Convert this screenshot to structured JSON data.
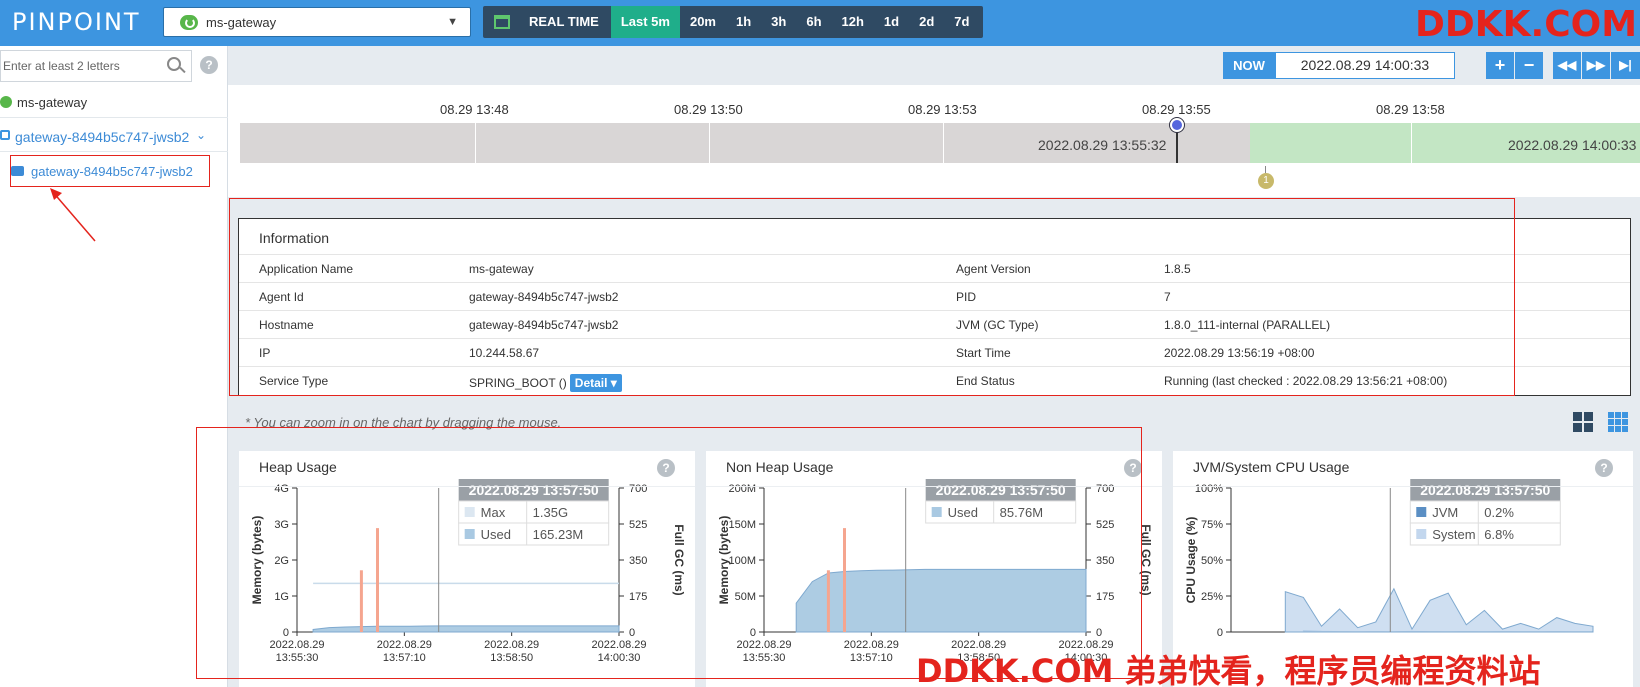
{
  "header": {
    "logo": "PINPOINT",
    "app_selected": "ms-gateway",
    "realtime_label": "REAL TIME",
    "ranges": [
      "Last 5m",
      "20m",
      "1h",
      "3h",
      "6h",
      "12h",
      "1d",
      "2d",
      "7d"
    ],
    "active_range": "Last 5m"
  },
  "watermark": {
    "top": "DDKK.COM",
    "bottom": "DDKK.COM 弟弟快看，程序员编程资料站"
  },
  "sidebar": {
    "search_placeholder": "Enter at least 2 letters",
    "help": "?",
    "app": "ms-gateway",
    "agent_group": "gateway-8494b5c747-jwsb2",
    "agent": "gateway-8494b5c747-jwsb2"
  },
  "time_control": {
    "now_label": "NOW",
    "now_value": "2022.08.29 14:00:33",
    "buttons": [
      "+",
      "−",
      "◀◀",
      "▶▶",
      "▶|"
    ]
  },
  "timeline": {
    "ticks": [
      "08.29 13:48",
      "08.29 13:50",
      "08.29 13:53",
      "08.29 13:55",
      "08.29 13:58"
    ],
    "range_start": "2022.08.29 13:55:32",
    "range_end": "2022.08.29 14:00:33",
    "event_count": "1"
  },
  "information": {
    "title": "Information",
    "rows": [
      {
        "k1": "Application Name",
        "v1": "ms-gateway",
        "k2": "Agent Version",
        "v2": "1.8.5"
      },
      {
        "k1": "Agent Id",
        "v1": "gateway-8494b5c747-jwsb2",
        "k2": "PID",
        "v2": "7"
      },
      {
        "k1": "Hostname",
        "v1": "gateway-8494b5c747-jwsb2",
        "k2": "JVM (GC Type)",
        "v2": "1.8.0_111-internal (PARALLEL)"
      },
      {
        "k1": "IP",
        "v1": "10.244.58.67",
        "k2": "Start Time",
        "v2": "2022.08.29 13:56:19 +08:00"
      },
      {
        "k1": "Service Type",
        "v1": "SPRING_BOOT ()",
        "k2": "End Status",
        "v2": "Running (last checked : 2022.08.29 13:56:21 +08:00)"
      }
    ],
    "detail_label": "Detail ▾"
  },
  "zoom_note": "* You can zoom in on the chart by dragging the mouse.",
  "colors": {
    "accent": "#3d95e0",
    "header": "#3d95e0",
    "active": "#1fae8a",
    "watermark": "#e4241d",
    "heap_fill": "#a9c9e2",
    "gc_bar": "#f5a58f"
  },
  "chart_data": [
    {
      "type": "area",
      "title": "Heap Usage",
      "ylabel": "Memory (bytes)",
      "y2label": "Full GC (ms)",
      "y_ticks": [
        "4G",
        "3G",
        "2G",
        "1G",
        "0"
      ],
      "y2_ticks": [
        "700",
        "525",
        "350",
        "175",
        "0"
      ],
      "x_ticks": [
        "2022.08.29",
        "2022.08.29",
        "2022.08.29",
        "2022.08.29"
      ],
      "x_ticks_line2": [
        "13:55:30",
        "13:57:10",
        "13:58:50",
        "14:00:30"
      ],
      "ylim": [
        0,
        4
      ],
      "y2lim": [
        0,
        700
      ],
      "series": [
        {
          "name": "Max",
          "values": [
            null,
            1.35,
            1.35,
            1.35,
            1.35,
            1.35,
            1.35,
            1.35,
            1.35,
            1.35,
            1.35,
            1.35,
            1.35,
            1.35,
            1.35,
            1.35,
            1.35,
            1.35,
            1.35,
            1.35,
            1.35
          ]
        },
        {
          "name": "Used",
          "values": [
            null,
            0.07,
            0.12,
            0.14,
            0.15,
            0.16,
            0.16,
            0.16,
            0.165,
            0.17,
            0.17,
            0.17,
            0.17,
            0.17,
            0.17,
            0.17,
            0.17,
            0.17,
            0.17,
            0.17,
            0.17
          ]
        }
      ],
      "gc_bars": [
        {
          "at": 0.2,
          "value": 300
        },
        {
          "at": 0.25,
          "value": 505
        }
      ],
      "tooltip": {
        "time": "2022.08.29 13:57:50",
        "rows": [
          {
            "label": "Max",
            "value": "1.35G"
          },
          {
            "label": "Used",
            "value": "165.23M"
          }
        ]
      },
      "cursor": 0.44
    },
    {
      "type": "area",
      "title": "Non Heap Usage",
      "ylabel": "Memory (bytes)",
      "y2label": "Full GC (ms)",
      "y_ticks": [
        "200M",
        "150M",
        "100M",
        "50M",
        "0"
      ],
      "y2_ticks": [
        "700",
        "525",
        "350",
        "175",
        "0"
      ],
      "x_ticks": [
        "2022.08.29",
        "2022.08.29",
        "2022.08.29",
        "2022.08.29"
      ],
      "x_ticks_line2": [
        "13:55:30",
        "13:57:10",
        "13:58:50",
        "14:00:30"
      ],
      "ylim": [
        0,
        200
      ],
      "y2lim": [
        0,
        700
      ],
      "series": [
        {
          "name": "Used",
          "values": [
            null,
            null,
            40,
            70,
            82,
            84,
            85,
            85.76,
            86,
            86.5,
            87,
            87,
            87,
            87,
            87,
            87,
            87,
            87,
            87,
            87,
            87
          ]
        }
      ],
      "gc_bars": [
        {
          "at": 0.2,
          "value": 300
        },
        {
          "at": 0.25,
          "value": 505
        }
      ],
      "tooltip": {
        "time": "2022.08.29 13:57:50",
        "rows": [
          {
            "label": "Used",
            "value": "85.76M"
          }
        ]
      },
      "cursor": 0.44
    },
    {
      "type": "area",
      "title": "JVM/System CPU Usage",
      "ylabel": "CPU Usage (%)",
      "y_ticks": [
        "100%",
        "75%",
        "50%",
        "25%",
        "0"
      ],
      "ylim": [
        0,
        100
      ],
      "series": [
        {
          "name": "JVM",
          "values": [
            null,
            null,
            null,
            null,
            1,
            0.5,
            0.3,
            0.2,
            0.3,
            0.2,
            0.4,
            0.3,
            0.2,
            0.3,
            0.2,
            0.3,
            0.2,
            0.2,
            0.3,
            0.2,
            0.2
          ]
        },
        {
          "name": "System",
          "values": [
            null,
            null,
            null,
            28,
            24,
            4,
            16,
            3,
            7,
            30,
            2,
            22,
            27,
            5,
            15,
            2,
            6,
            2,
            10,
            6,
            4
          ]
        }
      ],
      "tooltip": {
        "time": "2022.08.29 13:57:50",
        "rows": [
          {
            "label": "JVM",
            "value": "0.2%"
          },
          {
            "label": "System",
            "value": "6.8%"
          }
        ]
      },
      "cursor": 0.44
    }
  ]
}
